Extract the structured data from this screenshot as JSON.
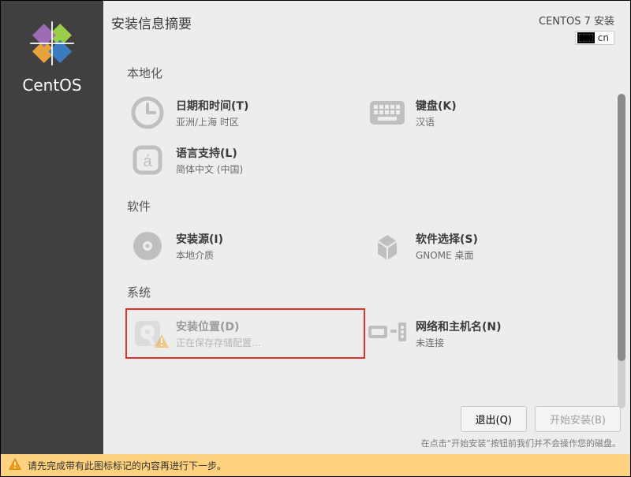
{
  "brand": "CentOS",
  "header": {
    "title": "安装信息摘要",
    "product": "CENTOS 7 安装",
    "keyboard_layout": "cn"
  },
  "sections": {
    "localization": {
      "title": "本地化",
      "datetime": {
        "title": "日期和时间(T)",
        "status": "亚洲/上海 时区"
      },
      "keyboard": {
        "title": "键盘(K)",
        "status": "汉语"
      },
      "language": {
        "title": "语言支持(L)",
        "status": "简体中文 (中国)"
      }
    },
    "software": {
      "title": "软件",
      "source": {
        "title": "安装源(I)",
        "status": "本地介质"
      },
      "selection": {
        "title": "软件选择(S)",
        "status": "GNOME 桌面"
      }
    },
    "system": {
      "title": "系统",
      "destination": {
        "title": "安装位置(D)",
        "status": "正在保存存储配置..."
      },
      "network": {
        "title": "网络和主机名(N)",
        "status": "未连接"
      }
    }
  },
  "footer": {
    "quit": "退出(Q)",
    "begin": "开始安装(B)",
    "hint": "在点击“开始安装”按钮前我们并不会操作您的磁盘。"
  },
  "warning": "请先完成带有此图标标记的内容再进行下一步。"
}
